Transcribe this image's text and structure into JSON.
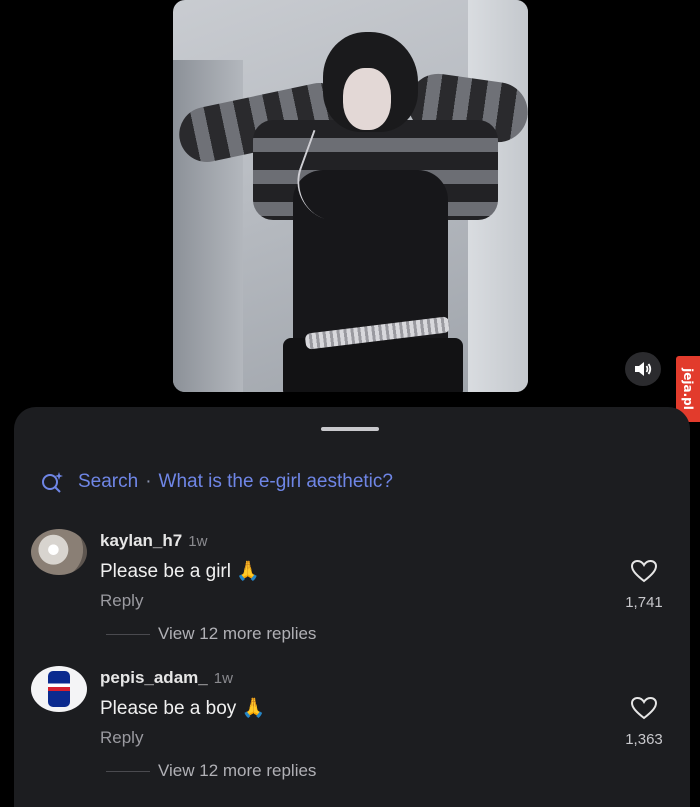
{
  "video": {
    "volume_icon": "speaker-icon"
  },
  "watermark": {
    "text": "jeja.pl",
    "color": "#e23b2c"
  },
  "sheet": {
    "search_prefix": "Search",
    "search_separator": "·",
    "search_query": "What is the e-girl aesthetic?",
    "search_color": "#6f86e6"
  },
  "comments": [
    {
      "username": "kaylan_h7",
      "time": "1w",
      "text": "Please be a girl",
      "emoji": "🙏",
      "reply_label": "Reply",
      "view_replies": "View 12 more replies",
      "likes": "1,741"
    },
    {
      "username": "pepis_adam_",
      "time": "1w",
      "text": "Please be a boy",
      "emoji": "🙏",
      "reply_label": "Reply",
      "view_replies": "View 12 more replies",
      "likes": "1,363"
    }
  ]
}
